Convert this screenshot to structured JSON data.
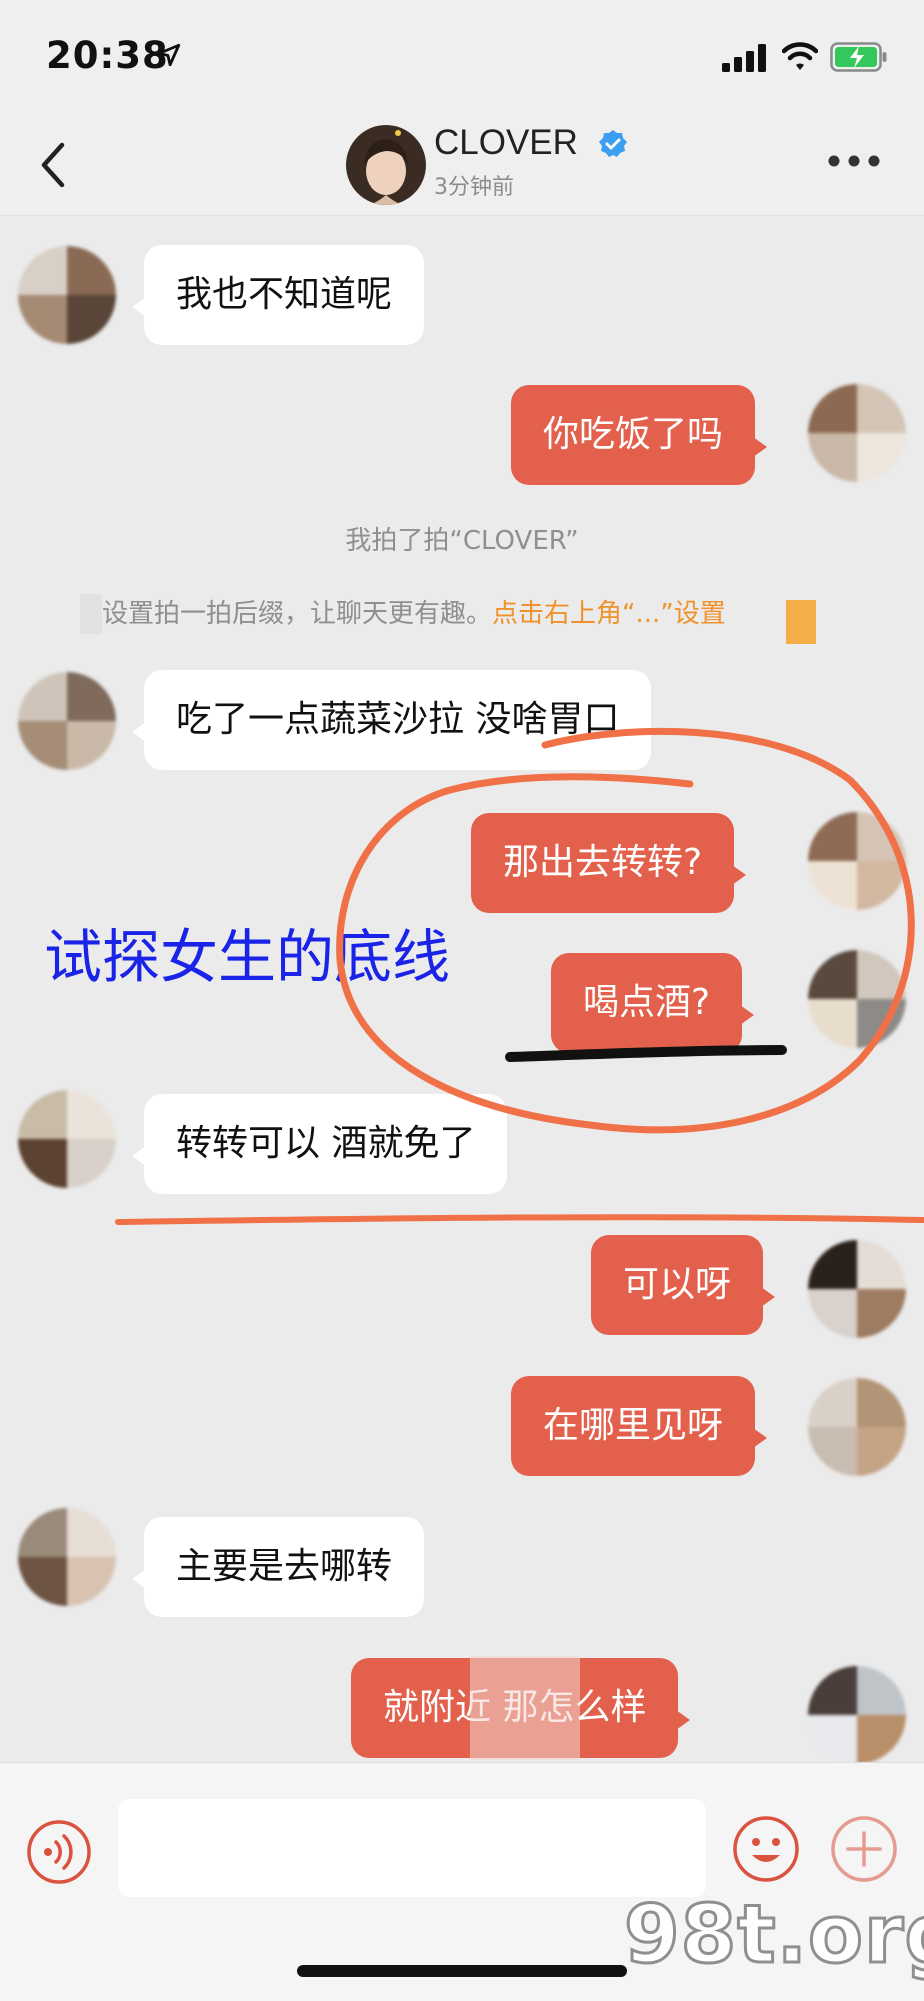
{
  "status_bar": {
    "time": "20:38",
    "icons": [
      "location-arrow-icon",
      "cellular-signal-icon",
      "wifi-icon",
      "battery-charging-icon"
    ]
  },
  "header": {
    "contact_name": "CLOVER",
    "last_seen": "3分钟前",
    "icons": [
      "back-chevron-icon",
      "verified-badge-icon",
      "more-dots-icon"
    ]
  },
  "messages": [
    {
      "side": "left",
      "text": "我也不知道呢"
    },
    {
      "side": "right",
      "text": "你吃饭了吗"
    },
    {
      "side": "left",
      "text": "吃了一点蔬菜沙拉 没啥胃口"
    },
    {
      "side": "right",
      "text": "那出去转转?"
    },
    {
      "side": "right",
      "text": "喝点酒?"
    },
    {
      "side": "left",
      "text": "转转可以  酒就免了"
    },
    {
      "side": "right",
      "text": "可以呀"
    },
    {
      "side": "right",
      "text": "在哪里见呀"
    },
    {
      "side": "left",
      "text": "主要是去哪转"
    },
    {
      "side": "right",
      "text": "就附近 那怎么样"
    }
  ],
  "system": {
    "pat_message": "我拍了拍“CLOVER”",
    "hint_text": "设置拍一拍后缀，让聊天更有趣。",
    "hint_link": "点击右上角“...”设置"
  },
  "annotation": {
    "text": "试探女生的底线",
    "color": "#1a23e8"
  },
  "input_bar": {
    "placeholder": "",
    "icons": [
      "voice-icon",
      "emoji-icon",
      "plus-icon"
    ]
  },
  "watermark": {
    "text": "98t.org"
  },
  "colors": {
    "outgoing_bubble": "#e3614c",
    "incoming_bubble": "#ffffff",
    "background": "#ebebeb",
    "annotation_stroke": "#f07048",
    "hint_link": "#f0922b"
  }
}
